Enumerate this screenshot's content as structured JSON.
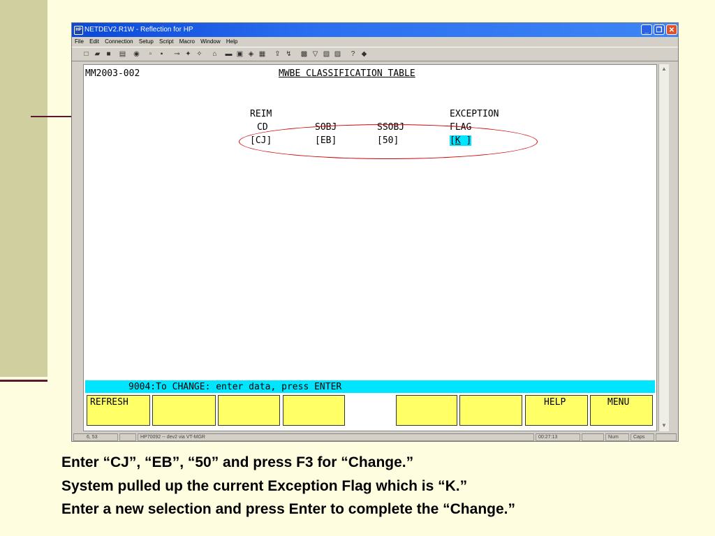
{
  "window": {
    "title": "NETDEV2.R1W - Reflection for HP",
    "icon_label": "HP",
    "minimize_icon": "_",
    "restore_icon": "❐",
    "close_icon": "✕"
  },
  "menu": [
    "File",
    "Edit",
    "Connection",
    "Setup",
    "Script",
    "Macro",
    "Window",
    "Help"
  ],
  "toolbar_icons": [
    "new-icon",
    "open-icon",
    "save-icon",
    "print-icon",
    "find-icon",
    "copy-icon",
    "paste-icon",
    "connect-icon",
    "disconnect-icon",
    "transfer-icon",
    "settings-icon",
    "keyboard-icon",
    "terminal-icon",
    "display-icon",
    "tools-icon",
    "upload-icon",
    "download-icon",
    "macro-icon",
    "record-icon",
    "window-icon",
    "help-icon",
    "info-icon"
  ],
  "terminal": {
    "screen_id": "MM2003-002",
    "title": "MWBE CLASSIFICATION TABLE",
    "col1_h1": "REIM",
    "col1_h2": "CD",
    "col2_h2": "SOBJ",
    "col3_h2": "SSOBJ",
    "col4_h1": "EXCEPTION",
    "col4_h2": "FLAG",
    "val1": "[CJ]",
    "val2": "[EB]",
    "val3": "[50]",
    "val4_open": "[",
    "val4_cursor": "K",
    "val4_close": " ]",
    "message": "9004:To CHANGE: enter data, press ENTER",
    "fkeys": [
      "REFRESH",
      "",
      "",
      "",
      "",
      "",
      "",
      "HELP",
      "MENU"
    ]
  },
  "status": {
    "cursor": "6, 53",
    "host": "HP70092 -- dev2 via VT-MGR",
    "time": "00:27:13",
    "num": "Num",
    "caps": "Caps"
  },
  "caption": {
    "line1": "Enter “CJ”, “EB”, “50” and press F3 for “Change.”",
    "line2": "System pulled up the current Exception Flag which is “K.”",
    "line3": "Enter a new selection and press Enter to complete the “Change.”"
  }
}
